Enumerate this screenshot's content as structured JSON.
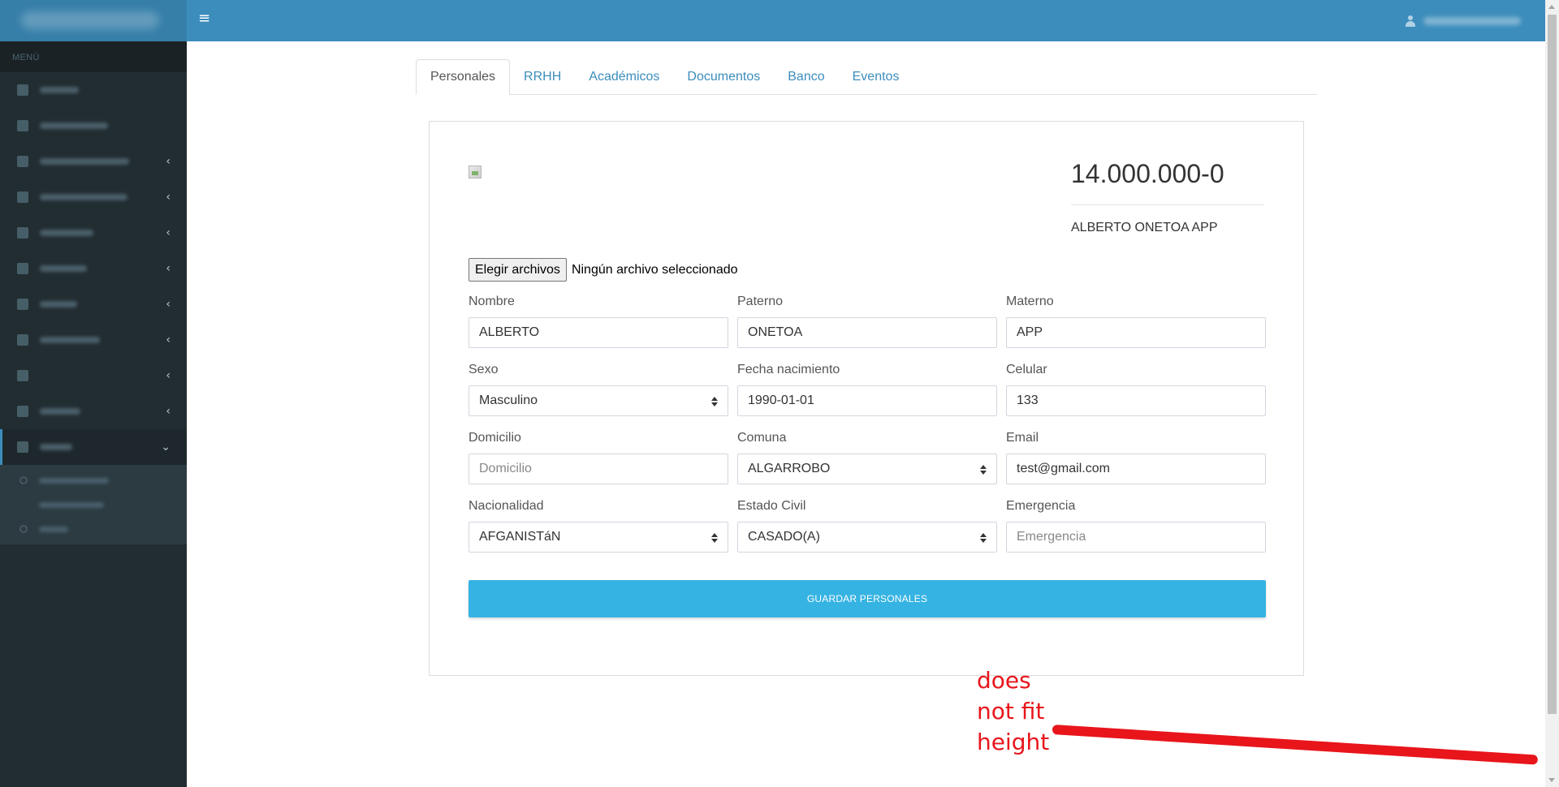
{
  "sidebar": {
    "header": "MENÚ"
  },
  "tabs": [
    {
      "label": "Personales",
      "active": true
    },
    {
      "label": "RRHH"
    },
    {
      "label": "Académicos"
    },
    {
      "label": "Documentos"
    },
    {
      "label": "Banco"
    },
    {
      "label": "Eventos"
    }
  ],
  "profile": {
    "rut": "14.000.000-0",
    "full_name": "ALBERTO ONETOA APP"
  },
  "file_input": {
    "button_label": "Elegir archivos",
    "status": "Ningún archivo seleccionado"
  },
  "form": {
    "nombre": {
      "label": "Nombre",
      "value": "ALBERTO"
    },
    "paterno": {
      "label": "Paterno",
      "value": "ONETOA"
    },
    "materno": {
      "label": "Materno",
      "value": "APP"
    },
    "sexo": {
      "label": "Sexo",
      "value": "Masculino"
    },
    "fecha_nacimiento": {
      "label": "Fecha nacimiento",
      "value": "1990-01-01"
    },
    "celular": {
      "label": "Celular",
      "value": "133"
    },
    "domicilio": {
      "label": "Domicilio",
      "placeholder": "Domicilio"
    },
    "comuna": {
      "label": "Comuna",
      "value": "ALGARROBO"
    },
    "email": {
      "label": "Email",
      "value": "test@gmail.com"
    },
    "nacionalidad": {
      "label": "Nacionalidad",
      "value": "AFGANISTáN"
    },
    "estado_civil": {
      "label": "Estado Civil",
      "value": "CASADO(A)"
    },
    "emergencia": {
      "label": "Emergencia",
      "placeholder": "Emergencia"
    }
  },
  "save_button": "GUARDAR PERSONALES",
  "annotation": {
    "line1": "does",
    "line2": "not fit",
    "line3": "height",
    "color": "#e8151b"
  },
  "colors": {
    "topbar": "#3c8dbc",
    "sidebar": "#222d32",
    "button": "#35b3e3",
    "link": "#3c8dbc"
  }
}
